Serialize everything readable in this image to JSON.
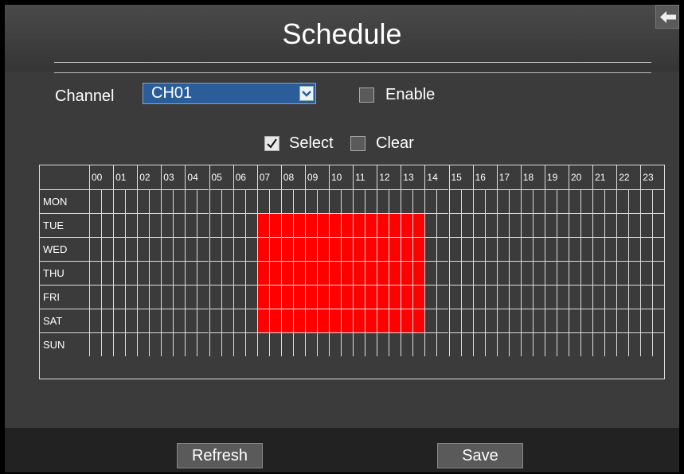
{
  "window": {
    "title": "Schedule"
  },
  "channel": {
    "label": "Channel",
    "value": "CH01"
  },
  "enable": {
    "label": "Enable",
    "checked": false
  },
  "modes": {
    "select": {
      "label": "Select",
      "checked": true
    },
    "clear": {
      "label": "Clear",
      "checked": false
    }
  },
  "schedule": {
    "hours": [
      "00",
      "01",
      "02",
      "03",
      "04",
      "05",
      "06",
      "07",
      "08",
      "09",
      "10",
      "11",
      "12",
      "13",
      "14",
      "15",
      "16",
      "17",
      "18",
      "19",
      "20",
      "21",
      "22",
      "23"
    ],
    "days": [
      "MON",
      "TUE",
      "WED",
      "THU",
      "FRI",
      "SAT",
      "SUN"
    ],
    "recording_days": [
      "TUE",
      "WED",
      "THU",
      "FRI",
      "SAT"
    ],
    "recording_hours": {
      "from": "07",
      "to": "13"
    },
    "active_color": "#ff0000"
  },
  "buttons": {
    "refresh": "Refresh",
    "save": "Save"
  }
}
